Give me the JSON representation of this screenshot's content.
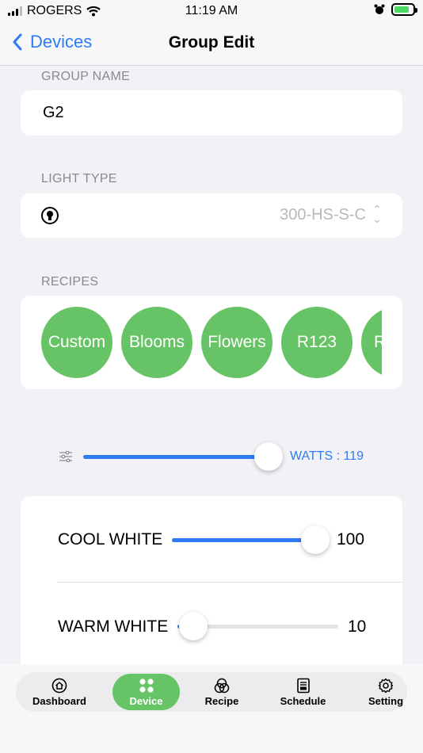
{
  "status_bar": {
    "carrier": "ROGERS",
    "time": "11:19 AM"
  },
  "nav": {
    "back_label": "Devices",
    "title": "Group Edit"
  },
  "group_name": {
    "label": "GROUP NAME",
    "value": "G2"
  },
  "light_type": {
    "label": "LIGHT TYPE",
    "value": "300-HS-S-C",
    "icon": "bulb-icon"
  },
  "recipes": {
    "label": "RECIPES",
    "items": [
      "Custom",
      "Blooms",
      "Flowers",
      "R123",
      "R"
    ],
    "color": "#67c466"
  },
  "master": {
    "watts_label": "WATTS : 119",
    "level_fraction": 1.0
  },
  "channels": [
    {
      "label": "COOL WHITE",
      "value": "100",
      "level_fraction": 1.0
    },
    {
      "label": "WARM WHITE",
      "value": "10",
      "level_fraction": 0.1
    }
  ],
  "tabs": [
    {
      "label": "Dashboard",
      "icon": "home-icon",
      "active": false
    },
    {
      "label": "Device",
      "icon": "grid-icon",
      "active": true
    },
    {
      "label": "Recipe",
      "icon": "recipe-icon",
      "active": false
    },
    {
      "label": "Schedule",
      "icon": "schedule-icon",
      "active": false
    },
    {
      "label": "Setting",
      "icon": "gear-icon",
      "active": false
    }
  ],
  "colors": {
    "accent": "#2f7bf5",
    "green": "#67c466",
    "background": "#f2f2f6"
  }
}
